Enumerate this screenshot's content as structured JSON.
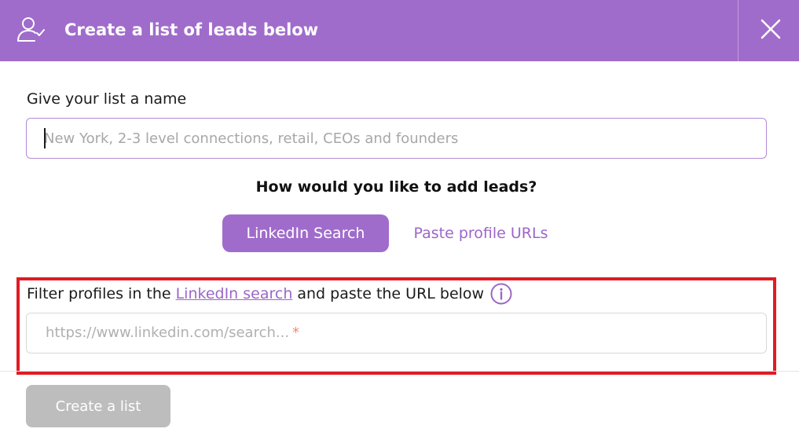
{
  "header": {
    "title": "Create a list of leads below",
    "icon": "user-check-icon",
    "close_icon": "close-icon",
    "background": "#a06ccb"
  },
  "form": {
    "name_label": "Give your list a name",
    "name_placeholder": "New York, 2-3 level connections, retail, CEOs and founders",
    "name_value": "",
    "question": "How would you like to add leads?",
    "tabs": [
      {
        "label": "LinkedIn Search",
        "selected": true
      },
      {
        "label": "Paste profile URLs",
        "selected": false
      }
    ],
    "filter": {
      "prefix": "Filter profiles in the",
      "link_text": "LinkedIn search",
      "suffix": "and paste the URL below",
      "info_icon": "info-icon"
    },
    "url_placeholder": "https://www.linkedin.com/search...",
    "url_required_mark": "*",
    "url_value": ""
  },
  "footer": {
    "create_label": "Create a list",
    "create_enabled": false
  },
  "colors": {
    "accent": "#a06ccb",
    "link": "#9c66c9",
    "highlight": "#e11b22",
    "disabled": "#bdbdbd",
    "required": "#ef8c6a"
  }
}
